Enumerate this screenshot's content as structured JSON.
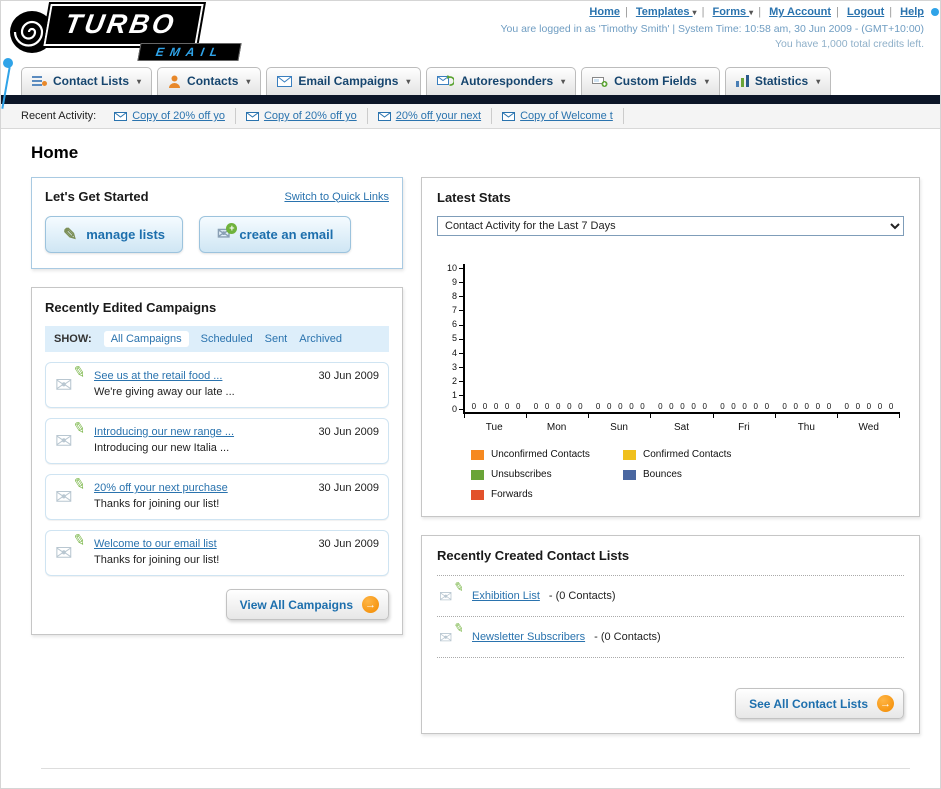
{
  "header": {
    "logo": {
      "title": "TURBO",
      "subtitle": "EMAIL"
    },
    "top_links": [
      "Home",
      "Templates",
      "Forms",
      "My Account",
      "Logout",
      "Help"
    ],
    "login_info": "You are logged in as 'Timothy Smith' | System Time: 10:58 am, 30 Jun 2009 - (GMT+10:00)",
    "credits_info": "You have 1,000 total credits left."
  },
  "nav": {
    "tabs": [
      "Contact Lists",
      "Contacts",
      "Email Campaigns",
      "Autoresponders",
      "Custom Fields",
      "Statistics"
    ]
  },
  "recent_activity": {
    "label": "Recent Activity:",
    "items": [
      "Copy of 20% off yo",
      "Copy of 20% off yo",
      "20% off your next",
      "Copy of Welcome t"
    ]
  },
  "page": {
    "title": "Home"
  },
  "get_started": {
    "title": "Let's Get Started",
    "switch_link": "Switch to Quick Links",
    "manage_lists_label": "manage lists",
    "create_email_label": "create an email"
  },
  "campaigns": {
    "title": "Recently Edited Campaigns",
    "show_label": "SHOW:",
    "filters": [
      "All Campaigns",
      "Scheduled",
      "Sent",
      "Archived"
    ],
    "items": [
      {
        "title": "See us at the retail food ...",
        "subtitle": "We're giving away our late ...",
        "date": "30 Jun 2009"
      },
      {
        "title": "Introducing our new range ...",
        "subtitle": "Introducing our new Italia ...",
        "date": "30 Jun 2009"
      },
      {
        "title": "20% off your next purchase",
        "subtitle": "Thanks for joining our list!",
        "date": "30 Jun 2009"
      },
      {
        "title": "Welcome to our email list",
        "subtitle": "Thanks for joining our list!",
        "date": "30 Jun 2009"
      }
    ],
    "view_all_label": "View All Campaigns"
  },
  "latest_stats": {
    "title": "Latest Stats",
    "dropdown_value": "Contact Activity for the Last 7 Days",
    "chart_data": {
      "type": "bar",
      "title": "Contact Activity for the Last 7 Days",
      "categories": [
        "Tue",
        "Mon",
        "Sun",
        "Sat",
        "Fri",
        "Thu",
        "Wed"
      ],
      "series": [
        {
          "name": "Unconfirmed Contacts",
          "color": "#f6891f",
          "values": [
            0,
            0,
            0,
            0,
            0,
            0,
            0
          ]
        },
        {
          "name": "Confirmed Contacts",
          "color": "#f0c01d",
          "values": [
            0,
            0,
            0,
            0,
            0,
            0,
            0
          ]
        },
        {
          "name": "Unsubscribes",
          "color": "#6aa437",
          "values": [
            0,
            0,
            0,
            0,
            0,
            0,
            0
          ]
        },
        {
          "name": "Bounces",
          "color": "#4a67a1",
          "values": [
            0,
            0,
            0,
            0,
            0,
            0,
            0
          ]
        },
        {
          "name": "Forwards",
          "color": "#e2512b",
          "values": [
            0,
            0,
            0,
            0,
            0,
            0,
            0
          ]
        }
      ],
      "ylim": [
        0,
        10
      ],
      "yticks": [
        0,
        1,
        2,
        3,
        4,
        5,
        6,
        7,
        8,
        9,
        10
      ],
      "xlabel": "",
      "ylabel": "",
      "grid": false,
      "legend_position": "bottom"
    }
  },
  "contact_lists": {
    "title": "Recently Created Contact Lists",
    "items": [
      {
        "name": "Exhibition List",
        "detail": "- (0 Contacts)"
      },
      {
        "name": "Newsletter Subscribers",
        "detail": "- (0 Contacts)"
      }
    ],
    "see_all_label": "See All Contact Lists"
  }
}
